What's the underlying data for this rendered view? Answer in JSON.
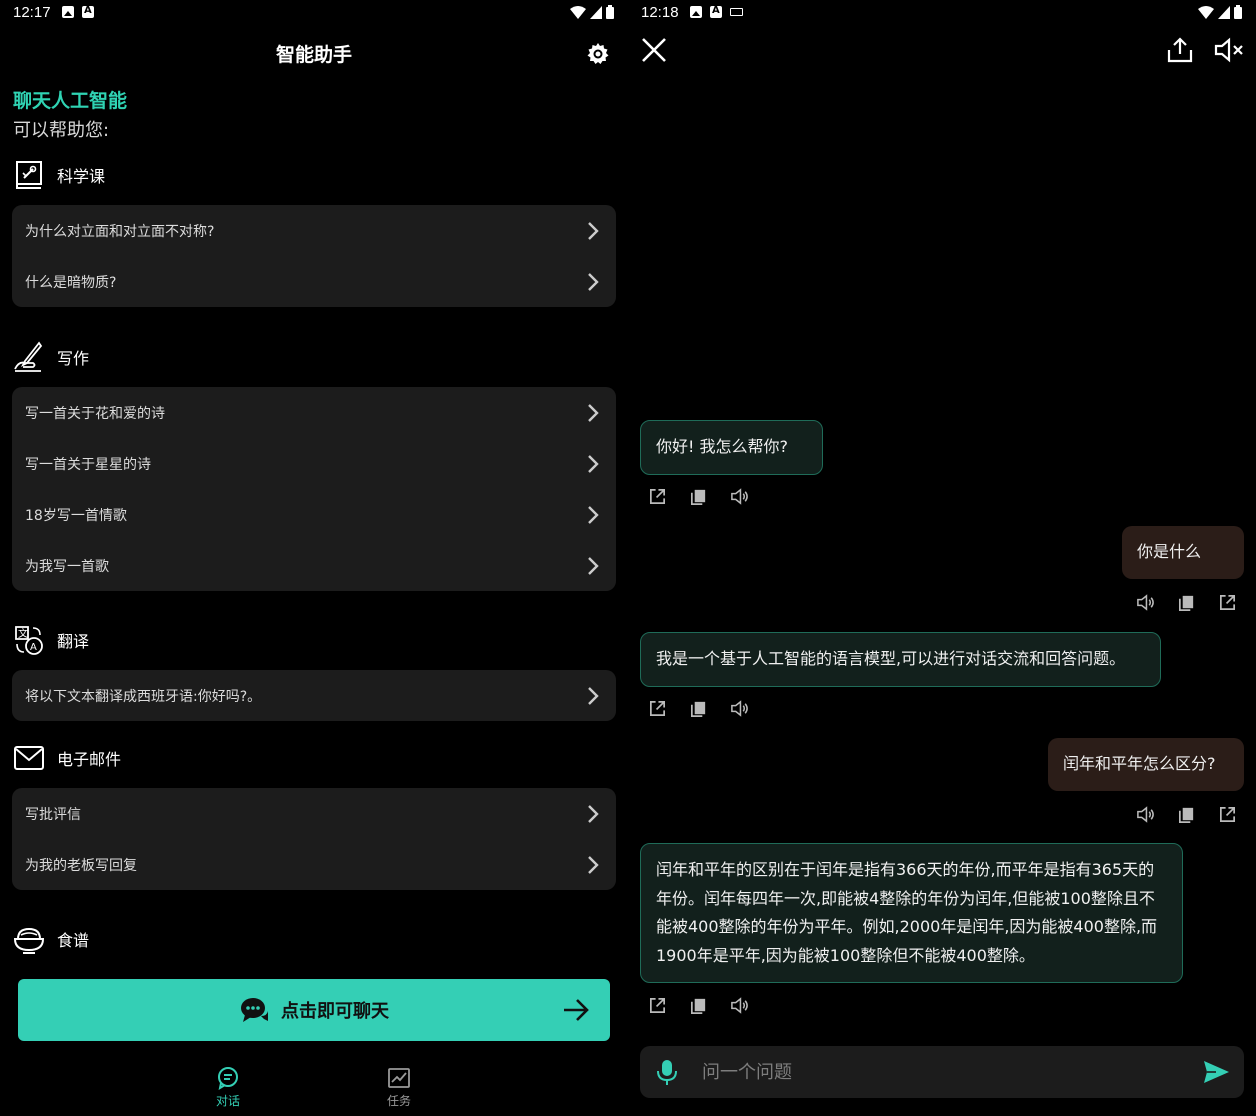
{
  "left": {
    "status_time": "12:17",
    "header_title": "智能助手",
    "brand": "聊天人工智能",
    "subtitle": "可以帮助您:",
    "sections": [
      {
        "title": "科学课",
        "icon": "science-book-icon",
        "items": [
          "为什么对立面和对立面不对称?",
          "什么是暗物质?"
        ]
      },
      {
        "title": "写作",
        "icon": "writing-hand-icon",
        "items": [
          "写一首关于花和爱的诗",
          "写一首关于星星的诗",
          "18岁写一首情歌",
          "为我写一首歌"
        ]
      },
      {
        "title": "翻译",
        "icon": "translate-icon",
        "items": [
          "将以下文本翻译成西班牙语:你好吗?。"
        ]
      },
      {
        "title": "电子邮件",
        "icon": "mail-icon",
        "items": [
          "写批评信",
          "为我的老板写回复"
        ]
      },
      {
        "title": "食谱",
        "icon": "recipe-bowl-icon",
        "items": []
      }
    ],
    "cta_label": "点击即可聊天",
    "nav": [
      {
        "label": "对话",
        "icon": "chat-icon",
        "active": true
      },
      {
        "label": "任务",
        "icon": "chart-icon",
        "active": false
      }
    ]
  },
  "right": {
    "status_time": "12:18",
    "messages": [
      {
        "role": "bot",
        "text": "你好! 我怎么帮你?"
      },
      {
        "role": "user",
        "text": "你是什么"
      },
      {
        "role": "bot",
        "text": "我是一个基于人工智能的语言模型,可以进行对话交流和回答问题。"
      },
      {
        "role": "user",
        "text": "闰年和平年怎么区分?"
      },
      {
        "role": "bot",
        "text": "闰年和平年的区别在于闰年是指有366天的年份,而平年是指有365天的年份。闰年每四年一次,即能被4整除的年份为闰年,但能被100整除且不能被400整除的年份为平年。例如,2000年是闰年,因为能被400整除,而1900年是平年,因为能被100整除但不能被400整除。"
      }
    ],
    "input_placeholder": "问一个问题"
  },
  "colors": {
    "accent": "#34cfb5",
    "brand_text": "#2fd3b3",
    "card_bg": "#1c1c1c",
    "bot_bubble_bg": "#12201c",
    "bot_bubble_border": "#1f6b58",
    "user_bubble_bg": "#2b1d18"
  }
}
